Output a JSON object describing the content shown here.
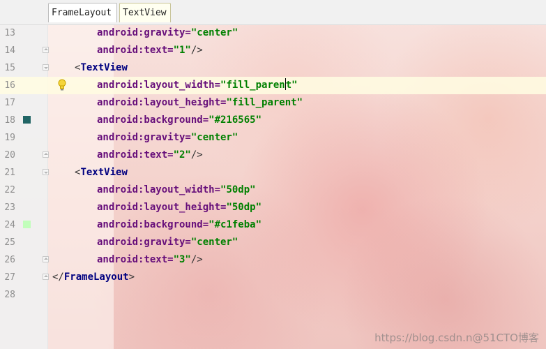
{
  "tabs": [
    {
      "label": "FrameLayout"
    },
    {
      "label": "TextView"
    }
  ],
  "lines": [
    {
      "num": "13",
      "attr": "android:gravity=",
      "val": "\"center\""
    },
    {
      "num": "14",
      "attr": "android:text=",
      "val": "\"1\"",
      "close": "/>"
    },
    {
      "num": "15",
      "tag": "TextView"
    },
    {
      "num": "16",
      "attr": "android:layout_width=",
      "val_before_caret": "\"fill_paren",
      "val_after_caret": "t\""
    },
    {
      "num": "17",
      "attr": "android:layout_height=",
      "val": "\"fill_parent\""
    },
    {
      "num": "18",
      "attr": "android:background=",
      "val": "\"#216565\"",
      "swatch_color": "#216565"
    },
    {
      "num": "19",
      "attr": "android:gravity=",
      "val": "\"center\""
    },
    {
      "num": "20",
      "attr": "android:text=",
      "val": "\"2\"",
      "close": "/>"
    },
    {
      "num": "21",
      "tag": "TextView"
    },
    {
      "num": "22",
      "attr": "android:layout_width=",
      "val": "\"50dp\""
    },
    {
      "num": "23",
      "attr": "android:layout_height=",
      "val": "\"50dp\""
    },
    {
      "num": "24",
      "attr": "android:background=",
      "val": "\"#c1feba\"",
      "swatch_color": "#c1feba"
    },
    {
      "num": "25",
      "attr": "android:gravity=",
      "val": "\"center\""
    },
    {
      "num": "26",
      "attr": "android:text=",
      "val": "\"3\"",
      "close": "/>"
    },
    {
      "num": "27",
      "close_tag": "FrameLayout"
    },
    {
      "num": "28"
    }
  ],
  "icons": {
    "intention": "lightbulb-icon",
    "fold_open": "fold-open-icon",
    "fold_close": "fold-close-icon"
  },
  "colors": {
    "attribute": "#660e7a",
    "value": "#008000",
    "tag": "#000080",
    "line_highlight": "#fffce1"
  },
  "watermark": "https://blog.csdn.n@51CTO博客"
}
